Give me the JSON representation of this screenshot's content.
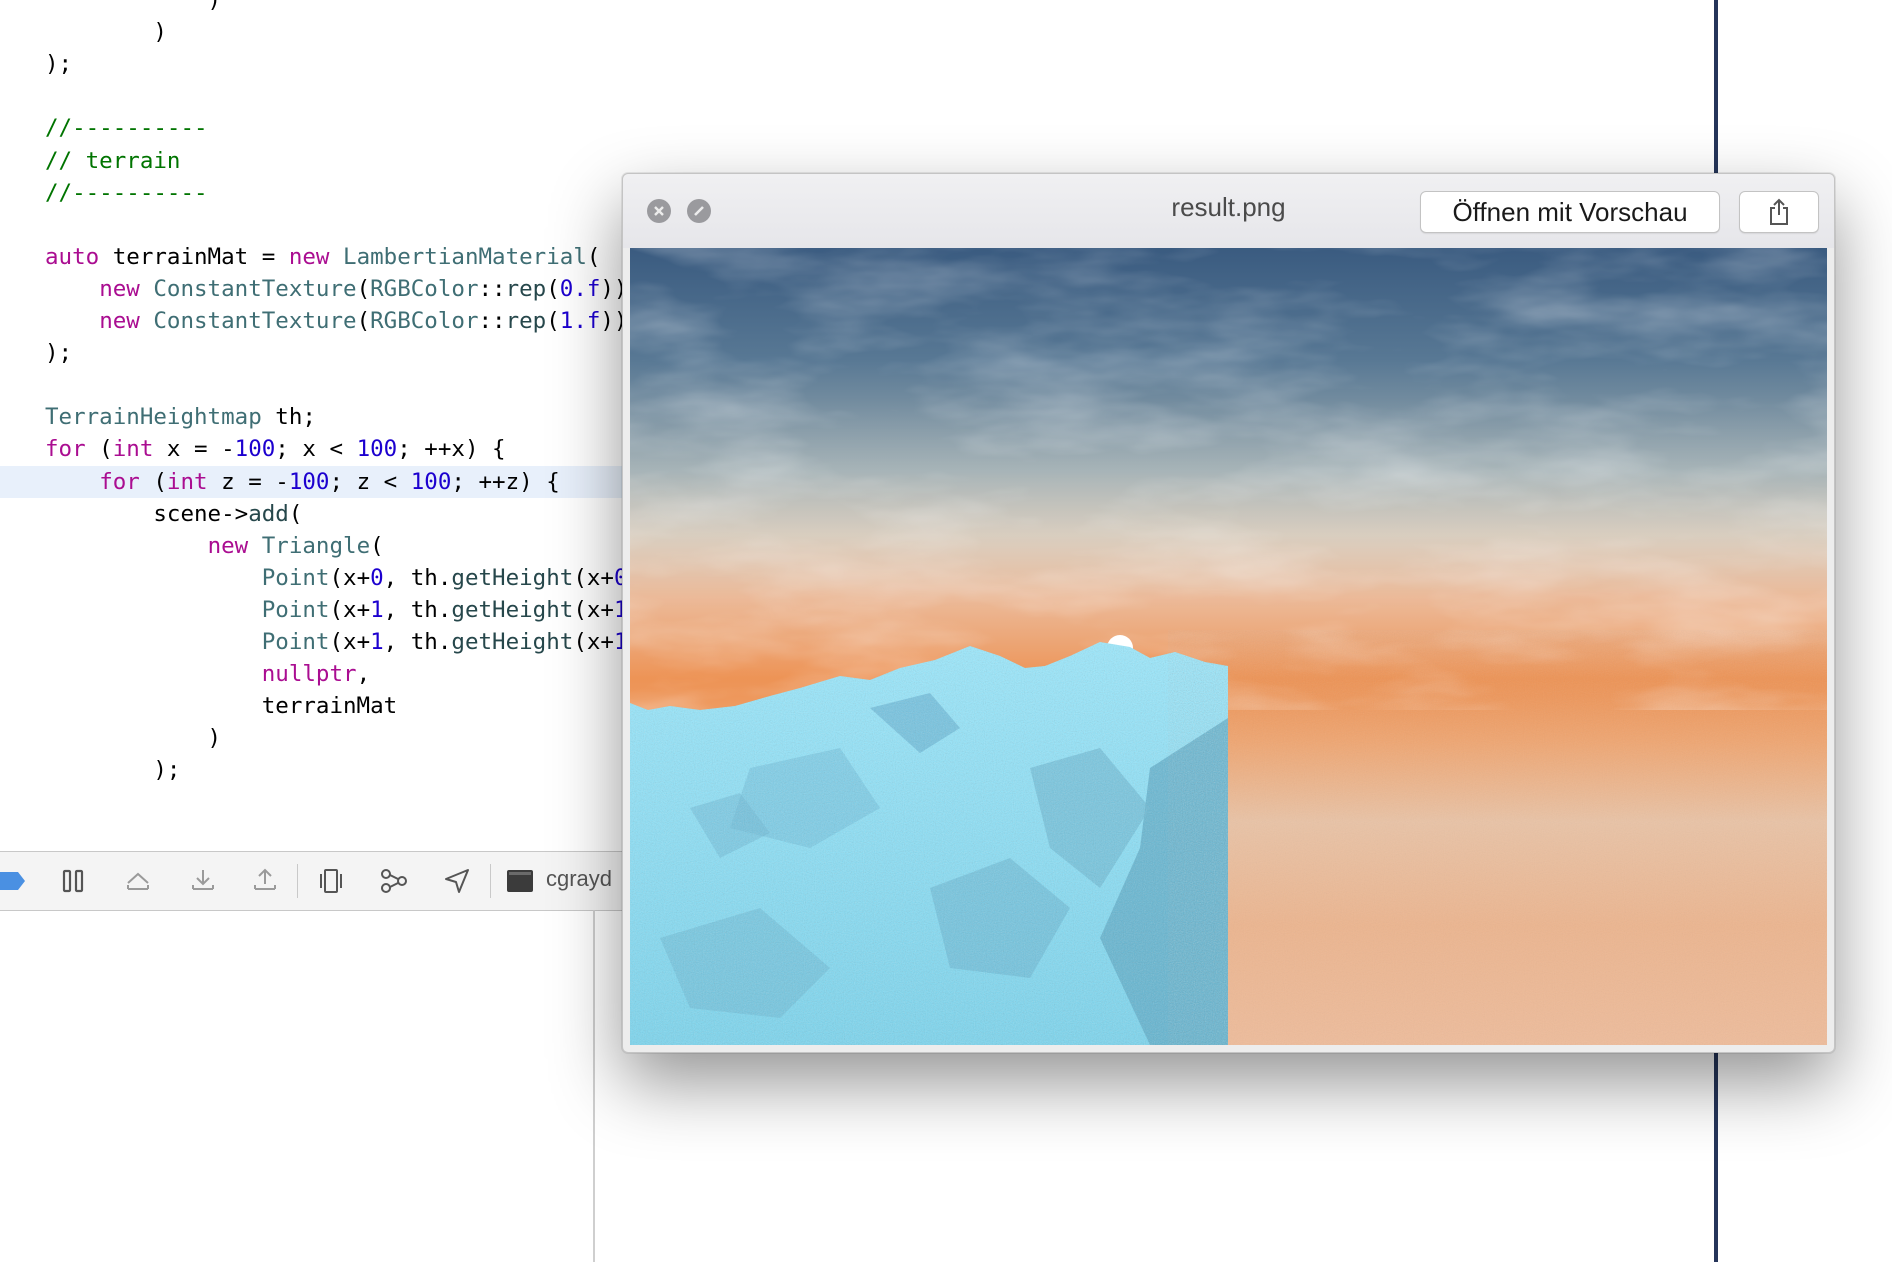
{
  "editor": {
    "lines": [
      {
        "segments": [
          {
            "t": "            )",
            "c": "pl"
          }
        ]
      },
      {
        "segments": [
          {
            "t": "        )",
            "c": "pl"
          }
        ]
      },
      {
        "segments": [
          {
            "t": ");",
            "c": "pl"
          }
        ]
      },
      {
        "segments": []
      },
      {
        "segments": [
          {
            "t": "//----------",
            "c": "cm"
          }
        ]
      },
      {
        "segments": [
          {
            "t": "// terrain",
            "c": "cm"
          }
        ]
      },
      {
        "segments": [
          {
            "t": "//----------",
            "c": "cm"
          }
        ]
      },
      {
        "segments": []
      },
      {
        "segments": [
          {
            "t": "auto",
            "c": "kw"
          },
          {
            "t": " terrainMat = ",
            "c": "pl"
          },
          {
            "t": "new",
            "c": "kw"
          },
          {
            "t": " ",
            "c": "pl"
          },
          {
            "t": "LambertianMaterial",
            "c": "type"
          },
          {
            "t": "(",
            "c": "pl"
          }
        ]
      },
      {
        "segments": [
          {
            "t": "    ",
            "c": "pl"
          },
          {
            "t": "new",
            "c": "kw"
          },
          {
            "t": " ",
            "c": "pl"
          },
          {
            "t": "ConstantTexture",
            "c": "type"
          },
          {
            "t": "(",
            "c": "pl"
          },
          {
            "t": "RGBColor",
            "c": "type"
          },
          {
            "t": "::",
            "c": "pl"
          },
          {
            "t": "rep",
            "c": "fn"
          },
          {
            "t": "(",
            "c": "pl"
          },
          {
            "t": "0.f",
            "c": "num"
          },
          {
            "t": ")),",
            "c": "pl"
          }
        ]
      },
      {
        "segments": [
          {
            "t": "    ",
            "c": "pl"
          },
          {
            "t": "new",
            "c": "kw"
          },
          {
            "t": " ",
            "c": "pl"
          },
          {
            "t": "ConstantTexture",
            "c": "type"
          },
          {
            "t": "(",
            "c": "pl"
          },
          {
            "t": "RGBColor",
            "c": "type"
          },
          {
            "t": "::",
            "c": "pl"
          },
          {
            "t": "rep",
            "c": "fn"
          },
          {
            "t": "(",
            "c": "pl"
          },
          {
            "t": "1.f",
            "c": "num"
          },
          {
            "t": "))",
            "c": "pl"
          }
        ]
      },
      {
        "segments": [
          {
            "t": ");",
            "c": "pl"
          }
        ]
      },
      {
        "segments": []
      },
      {
        "segments": [
          {
            "t": "TerrainHeightmap",
            "c": "type"
          },
          {
            "t": " th;",
            "c": "pl"
          }
        ]
      },
      {
        "segments": [
          {
            "t": "for",
            "c": "kw"
          },
          {
            "t": " (",
            "c": "pl"
          },
          {
            "t": "int",
            "c": "kw"
          },
          {
            "t": " x = -",
            "c": "pl"
          },
          {
            "t": "100",
            "c": "num"
          },
          {
            "t": "; x < ",
            "c": "pl"
          },
          {
            "t": "100",
            "c": "num"
          },
          {
            "t": "; ++x) {",
            "c": "pl"
          }
        ]
      },
      {
        "segments": [
          {
            "t": "    ",
            "c": "pl"
          },
          {
            "t": "for",
            "c": "kw"
          },
          {
            "t": " (",
            "c": "pl"
          },
          {
            "t": "int",
            "c": "kw"
          },
          {
            "t": " z = -",
            "c": "pl"
          },
          {
            "t": "100",
            "c": "num"
          },
          {
            "t": "; z < ",
            "c": "pl"
          },
          {
            "t": "100",
            "c": "num"
          },
          {
            "t": "; ++z) {",
            "c": "pl"
          }
        ],
        "current": true
      },
      {
        "segments": [
          {
            "t": "        scene->",
            "c": "pl"
          },
          {
            "t": "add",
            "c": "fn"
          },
          {
            "t": "(",
            "c": "pl"
          }
        ]
      },
      {
        "segments": [
          {
            "t": "            ",
            "c": "pl"
          },
          {
            "t": "new",
            "c": "kw"
          },
          {
            "t": " ",
            "c": "pl"
          },
          {
            "t": "Triangle",
            "c": "type"
          },
          {
            "t": "(",
            "c": "pl"
          }
        ]
      },
      {
        "segments": [
          {
            "t": "                ",
            "c": "pl"
          },
          {
            "t": "Point",
            "c": "type"
          },
          {
            "t": "(x+",
            "c": "pl"
          },
          {
            "t": "0",
            "c": "num"
          },
          {
            "t": ", th.",
            "c": "pl"
          },
          {
            "t": "getHeight",
            "c": "fn"
          },
          {
            "t": "(x+",
            "c": "pl"
          },
          {
            "t": "0",
            "c": "num"
          }
        ]
      },
      {
        "segments": [
          {
            "t": "                ",
            "c": "pl"
          },
          {
            "t": "Point",
            "c": "type"
          },
          {
            "t": "(x+",
            "c": "pl"
          },
          {
            "t": "1",
            "c": "num"
          },
          {
            "t": ", th.",
            "c": "pl"
          },
          {
            "t": "getHeight",
            "c": "fn"
          },
          {
            "t": "(x+",
            "c": "pl"
          },
          {
            "t": "1",
            "c": "num"
          }
        ]
      },
      {
        "segments": [
          {
            "t": "                ",
            "c": "pl"
          },
          {
            "t": "Point",
            "c": "type"
          },
          {
            "t": "(x+",
            "c": "pl"
          },
          {
            "t": "1",
            "c": "num"
          },
          {
            "t": ", th.",
            "c": "pl"
          },
          {
            "t": "getHeight",
            "c": "fn"
          },
          {
            "t": "(x+",
            "c": "pl"
          },
          {
            "t": "1",
            "c": "num"
          }
        ]
      },
      {
        "segments": [
          {
            "t": "                ",
            "c": "pl"
          },
          {
            "t": "nullptr",
            "c": "kw"
          },
          {
            "t": ",",
            "c": "pl"
          }
        ]
      },
      {
        "segments": [
          {
            "t": "                terrainMat",
            "c": "pl"
          }
        ]
      },
      {
        "segments": [
          {
            "t": "            )",
            "c": "pl"
          }
        ]
      },
      {
        "segments": [
          {
            "t": "        );",
            "c": "pl"
          }
        ]
      }
    ]
  },
  "debug_toolbar": {
    "target_label": "cgrayd",
    "buttons": [
      {
        "name": "breakpoints-icon"
      },
      {
        "name": "pause-icon"
      },
      {
        "name": "step-over-icon"
      },
      {
        "name": "step-into-icon"
      },
      {
        "name": "step-out-icon"
      },
      {
        "name": "view-hierarchy-icon"
      },
      {
        "name": "memory-graph-icon"
      },
      {
        "name": "simulate-location-icon"
      },
      {
        "name": "terminal-icon"
      }
    ]
  },
  "quicklook": {
    "title": "result.png",
    "open_button_label": "Öffnen mit Vorschau",
    "share_icon": "share-icon",
    "close_icon": "close-icon",
    "fullscreen_icon": "fullscreen-icon"
  },
  "colors": {
    "keyword": "#aa0d91",
    "type": "#3f6e74",
    "number": "#1c00cf",
    "comment": "#007400",
    "sky_top": "#3d5e82",
    "sky_orange": "#ec9050",
    "terrain": "#8fe6fb"
  }
}
